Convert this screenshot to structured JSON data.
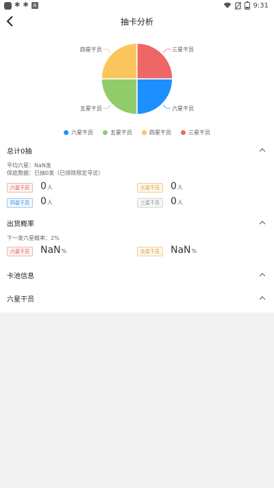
{
  "status_bar": {
    "time": "9:31",
    "battery": "9"
  },
  "header": {
    "title": "抽卡分析"
  },
  "chart_data": {
    "type": "pie",
    "categories": [
      "六星干员",
      "五星干员",
      "四星干员",
      "三星干员"
    ],
    "values": [
      1,
      1,
      1,
      1
    ],
    "colors": [
      "#1e8fff",
      "#90cc6a",
      "#fac65c",
      "#ee6666"
    ],
    "legend": "bottom"
  },
  "total": {
    "title": "总计0抽",
    "avg_six": "平均六星：NaN发",
    "pity": "保底数据：已抽0发（已排除限定寻访）",
    "items": [
      {
        "label": "六星干员",
        "value": "0",
        "unit": "人"
      },
      {
        "label": "五星干员",
        "value": "0",
        "unit": "人"
      },
      {
        "label": "四星干员",
        "value": "0",
        "unit": "人"
      },
      {
        "label": "三星干员",
        "value": "0",
        "unit": "人"
      }
    ]
  },
  "rate": {
    "title": "出货概率",
    "next_six": "下一发六星概率：2%",
    "items": [
      {
        "label": "六星干员",
        "value": "NaN",
        "unit": "%"
      },
      {
        "label": "五星干员",
        "value": "NaN",
        "unit": "%"
      }
    ]
  },
  "pool": {
    "title": "卡池信息"
  },
  "six_star": {
    "title": "六星干员"
  }
}
